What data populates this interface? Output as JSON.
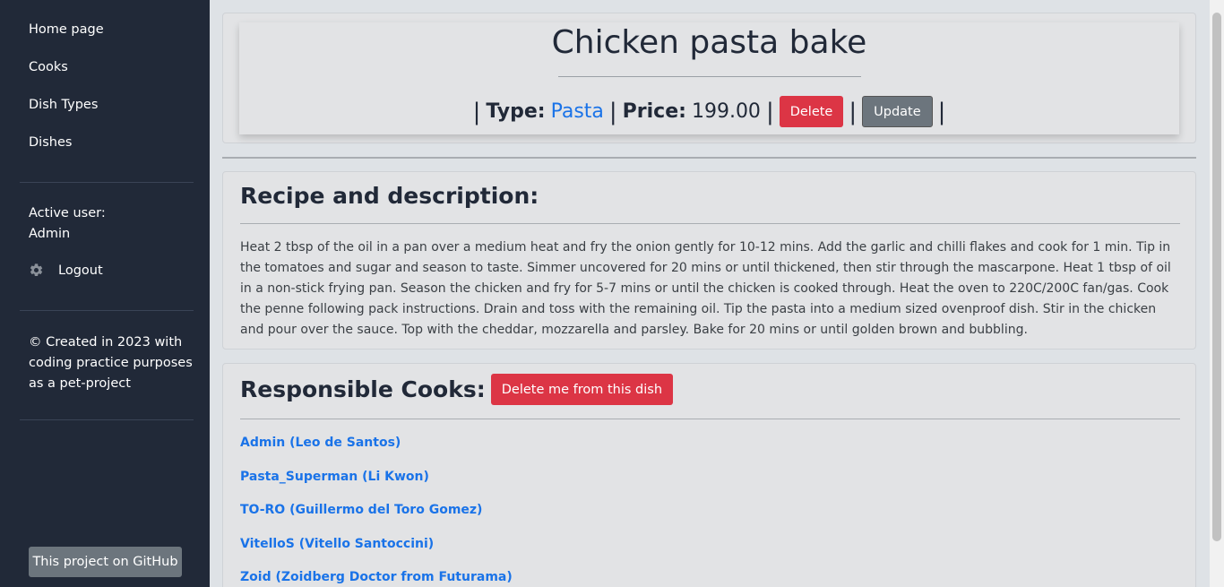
{
  "sidebar": {
    "nav": [
      "Home page",
      "Cooks",
      "Dish Types",
      "Dishes"
    ],
    "active_user_label": "Active user:",
    "active_user_name": "Admin",
    "logout_label": "Logout",
    "footer_note_lines": [
      "© Created in 2023 with",
      "coding practice purposes",
      "as a pet-project"
    ],
    "github_label": "This project on GitHub"
  },
  "dish": {
    "title": "Chicken pasta bake",
    "type_label": "Type:",
    "type_value": "Pasta",
    "price_label": "Price:",
    "price_value": "199.00",
    "delete_label": "Delete",
    "update_label": "Update"
  },
  "recipe": {
    "heading": "Recipe and description:",
    "text": "Heat 2 tbsp of the oil in a pan over a medium heat and fry the onion gently for 10-12 mins. Add the garlic and chilli flakes and cook for 1 min. Tip in the tomatoes and sugar and season to taste. Simmer uncovered for 20 mins or until thickened, then stir through the mascarpone. Heat 1 tbsp of oil in a non-stick frying pan. Season the chicken and fry for 5-7 mins or until the chicken is cooked through. Heat the oven to 220C/200C fan/gas. Cook the penne following pack instructions. Drain and toss with the remaining oil. Tip the pasta into a medium sized ovenproof dish. Stir in the chicken and pour over the sauce. Top with the cheddar, mozzarella and parsley. Bake for 20 mins or until golden brown and bubbling."
  },
  "cooks": {
    "heading": "Responsible Cooks:",
    "delete_me_label": "Delete me from this dish",
    "list": [
      "Admin (Leo de Santos)",
      "Pasta_Superman (Li Kwon)",
      "TO-RO (Guillermo del Toro Gomez)",
      "VitelloS (Vitello Santoccini)",
      "Zoid (Zoidberg Doctor from Futurama)"
    ]
  },
  "icons": {
    "logout": "gear-icon"
  },
  "colors": {
    "sidebar_bg": "#212938",
    "link": "#1a73e8",
    "danger": "#dc3545",
    "secondary": "#6c757d"
  }
}
